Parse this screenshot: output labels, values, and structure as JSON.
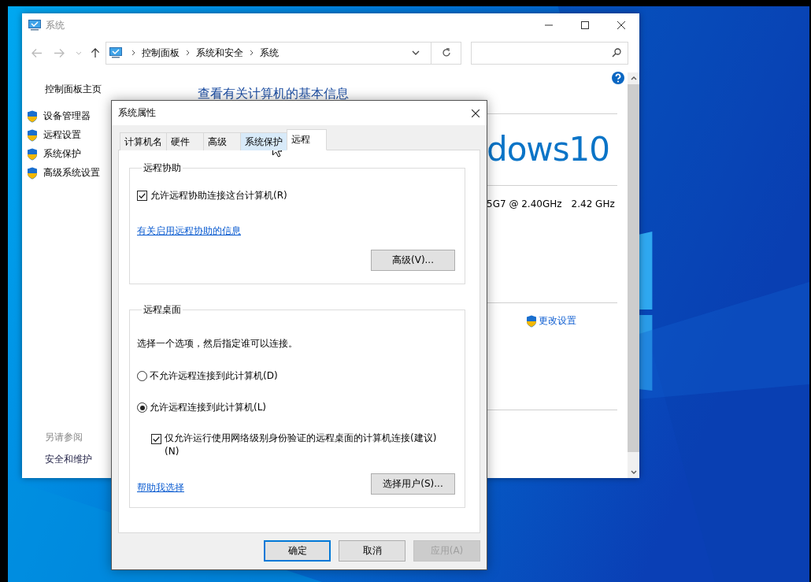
{
  "explorer": {
    "title": "系统",
    "breadcrumb": [
      "控制面板",
      "系统和安全",
      "系统"
    ],
    "sidebar": {
      "home": "控制面板主页",
      "items": [
        "设备管理器",
        "远程设置",
        "系统保护",
        "高级系统设置"
      ],
      "see_also_heading": "另请参阅",
      "see_also": [
        "安全和维护"
      ]
    },
    "main": {
      "heading": "查看有关计算机的基本信息",
      "edition_logo": "dows10",
      "processor": "5G7 @ 2.40GHz",
      "processor_speed": "2.42 GHz",
      "change_settings": "更改设置"
    }
  },
  "dialog": {
    "title": "系统属性",
    "tabs": [
      {
        "label": "计算机名",
        "selected": false,
        "hovered": false
      },
      {
        "label": "硬件",
        "selected": false,
        "hovered": false
      },
      {
        "label": "高级",
        "selected": false,
        "hovered": false
      },
      {
        "label": "系统保护",
        "selected": false,
        "hovered": true
      },
      {
        "label": "远程",
        "selected": true,
        "hovered": false
      }
    ],
    "remote_assistance": {
      "legend": "远程协助",
      "allow": {
        "label": "允许远程协助连接这台计算机(R)",
        "checked": true
      },
      "info_link": "有关启用远程协助的信息",
      "advanced_button": "高级(V)..."
    },
    "remote_desktop": {
      "legend": "远程桌面",
      "instruction": "选择一个选项，然后指定谁可以连接。",
      "options": [
        {
          "label": "不允许远程连接到此计算机(D)",
          "selected": false
        },
        {
          "label": "允许远程连接到此计算机(L)",
          "selected": true
        }
      ],
      "nla": {
        "label": "仅允许运行使用网络级别身份验证的远程桌面的计算机连接(建议)(N)",
        "checked": true
      },
      "help_link": "帮助我选择",
      "select_users_button": "选择用户(S)..."
    },
    "buttons": [
      {
        "label": "确定",
        "default": true,
        "disabled": false
      },
      {
        "label": "取消",
        "default": false,
        "disabled": false
      },
      {
        "label": "应用(A)",
        "default": false,
        "disabled": true
      }
    ]
  }
}
